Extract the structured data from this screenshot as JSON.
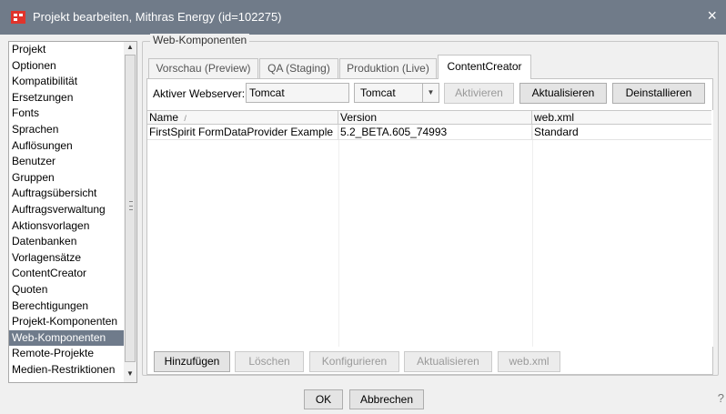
{
  "window": {
    "title": "Projekt bearbeiten, Mithras Energy (id=102275)",
    "close_label": "×",
    "title_bg": "#707b89",
    "icon_color": "#e0342b"
  },
  "nav": {
    "items": [
      "Projekt",
      "Optionen",
      "Kompatibilität",
      "Ersetzungen",
      "Fonts",
      "Sprachen",
      "Auflösungen",
      "Benutzer",
      "Gruppen",
      "Auftragsübersicht",
      "Auftragsverwaltung",
      "Aktionsvorlagen",
      "Datenbanken",
      "Vorlagensätze",
      "ContentCreator",
      "Quoten",
      "Berechtigungen",
      "Projekt-Komponenten",
      "Web-Komponenten",
      "Remote-Projekte",
      "Medien-Restriktionen"
    ],
    "selected": "Web-Komponenten",
    "scroll_up": "▲",
    "scroll_down": "▼"
  },
  "group": {
    "title": "Web-Komponenten"
  },
  "tabs": [
    {
      "label": "Vorschau (Preview)"
    },
    {
      "label": "QA (Staging)"
    },
    {
      "label": "Produktion (Live)"
    },
    {
      "label": "ContentCreator"
    }
  ],
  "active_tab": "ContentCreator",
  "webserver": {
    "label": "Aktiver Webserver:",
    "value": "Tomcat",
    "select_value": "Tomcat",
    "dropdown_arrow": "▼",
    "activate_label": "Aktivieren",
    "update_label": "Aktualisieren",
    "uninstall_label": "Deinstallieren"
  },
  "table": {
    "columns": [
      "Name",
      "Version",
      "web.xml"
    ],
    "sort_indicator": "/",
    "rows": [
      [
        "FirstSpirit FormDataProvider Example",
        "5.2_BETA.605_74993",
        "Standard"
      ]
    ]
  },
  "actions": {
    "add": "Hinzufügen",
    "delete": "Löschen",
    "configure": "Konfigurieren",
    "update": "Aktualisieren",
    "webxml": "web.xml"
  },
  "dialog": {
    "ok": "OK",
    "cancel": "Abbrechen",
    "help": "?"
  }
}
